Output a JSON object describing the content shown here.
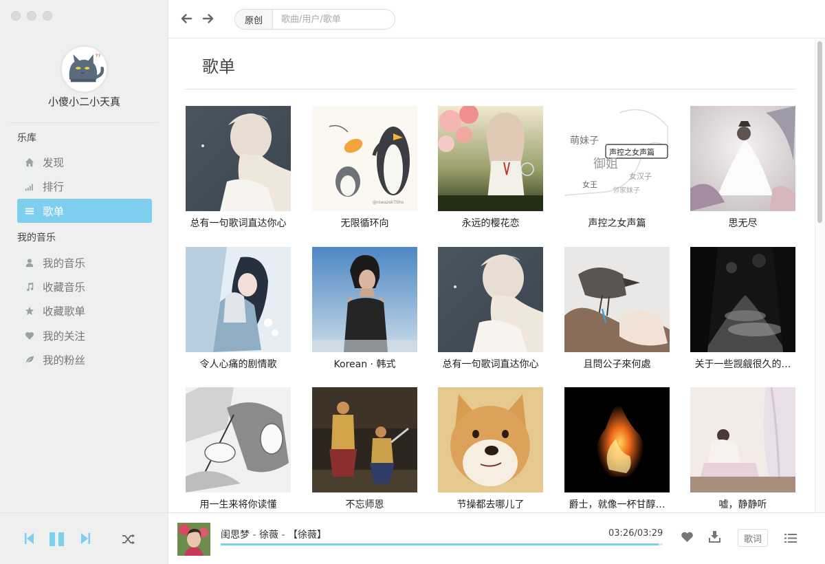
{
  "user": {
    "name": "小傻小二小天真"
  },
  "sidebar": {
    "library_title": "乐库",
    "library_items": [
      {
        "label": "发现",
        "icon": "home-icon"
      },
      {
        "label": "排行",
        "icon": "chart-bars-icon"
      },
      {
        "label": "歌单",
        "icon": "list-icon",
        "active": true
      }
    ],
    "my_music_title": "我的音乐",
    "my_items": [
      {
        "label": "我的音乐",
        "icon": "user-icon"
      },
      {
        "label": "收藏音乐",
        "icon": "music-note-icon"
      },
      {
        "label": "收藏歌单",
        "icon": "star-icon"
      },
      {
        "label": "我的关注",
        "icon": "heart-icon"
      },
      {
        "label": "我的粉丝",
        "icon": "leaf-icon"
      }
    ]
  },
  "search": {
    "type": "原创",
    "placeholder": "歌曲/用户/歌单"
  },
  "page": {
    "title": "歌单"
  },
  "playlists": [
    {
      "name": "总有一句歌词直达你心"
    },
    {
      "name": "无限循环向"
    },
    {
      "name": "永远的樱花恋"
    },
    {
      "name": "声控之女声篇",
      "cover_words": [
        "萌妹子",
        "声控之女声篇",
        "御姐",
        "女汉子",
        "女王",
        "邻家妹子"
      ]
    },
    {
      "name": "思无尽"
    },
    {
      "name": "令人心痛的剧情歌"
    },
    {
      "name": "Korean · 韩式"
    },
    {
      "name": "总有一句歌词直达你心"
    },
    {
      "name": "且問公子來何處"
    },
    {
      "name": "关于一些觊觎很久的…"
    },
    {
      "name": "用一生来将你读懂"
    },
    {
      "name": "不忘师恩"
    },
    {
      "name": "节操都去哪儿了"
    },
    {
      "name": "爵士，就像一杯甘醇…"
    },
    {
      "name": "嘘，静静听"
    }
  ],
  "player": {
    "song": "闺思梦",
    "artist": "徐薇",
    "album": "【徐薇】",
    "time": "03:26/03:29",
    "progress_percent": 99,
    "lyric_label": "歌词"
  },
  "colors": {
    "accent": "#7ecef0",
    "sidebar_bg": "#eef0f0"
  }
}
